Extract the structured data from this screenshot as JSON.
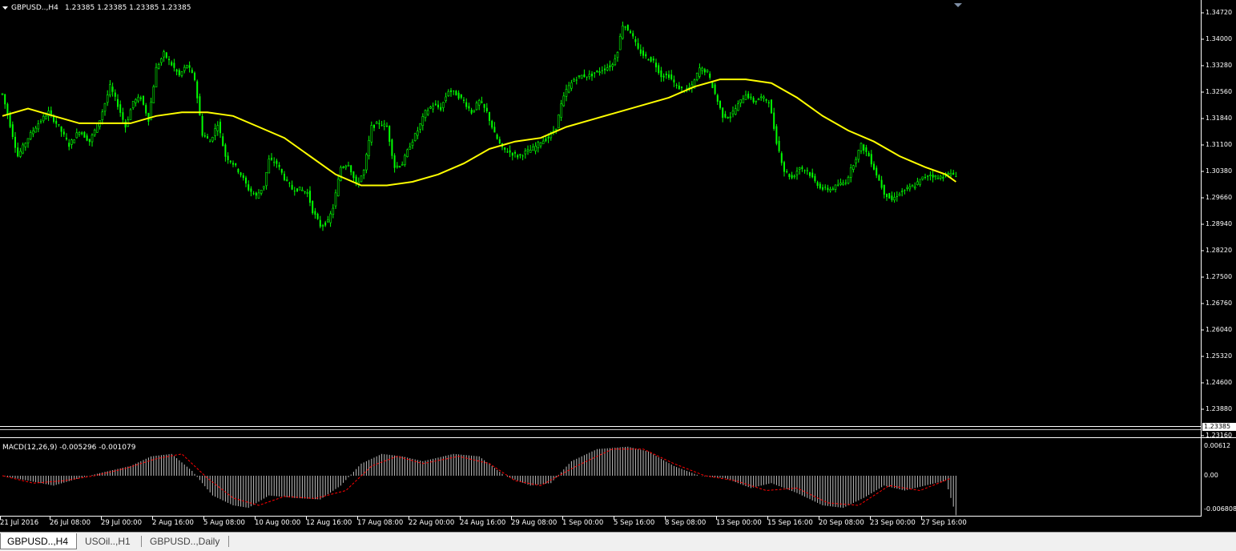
{
  "colors": {
    "background": "#000000",
    "axis": "#ffffff",
    "candle": "#00ff00",
    "moving_average": "#ffff00",
    "macd_histogram": "#c0c0c0",
    "macd_signal": "#ff0000",
    "bid_line": "#c0c0c0"
  },
  "chart_header": {
    "menu_icon": "triangle-down-icon",
    "symbol": "GBPUSD..,H4",
    "ohlc": "1.23385 1.23385 1.23385 1.23385"
  },
  "macd_header": {
    "label": "MACD(12,26,9) -0.005296 -0.001079"
  },
  "price_axis": {
    "ticks": [
      "1.34720",
      "1.34000",
      "1.33280",
      "1.32560",
      "1.31840",
      "1.31100",
      "1.30380",
      "1.29660",
      "1.28940",
      "1.28220",
      "1.27500",
      "1.26760",
      "1.26040",
      "1.25320",
      "1.24600",
      "1.23880",
      "1.23160"
    ],
    "current_price": "1.23385"
  },
  "macd_axis": {
    "ticks": [
      "0.00612",
      "0.00",
      "-0.006808"
    ]
  },
  "time_axis": {
    "labels": [
      "21 Jul 2016",
      "26 Jul 08:00",
      "29 Jul 00:00",
      "2 Aug 16:00",
      "5 Aug 08:00",
      "10 Aug 00:00",
      "12 Aug 16:00",
      "17 Aug 08:00",
      "22 Aug 00:00",
      "24 Aug 16:00",
      "29 Aug 08:00",
      "1 Sep 00:00",
      "5 Sep 16:00",
      "8 Sep 08:00",
      "13 Sep 00:00",
      "15 Sep 16:00",
      "20 Sep 08:00",
      "23 Sep 00:00",
      "27 Sep 16:00"
    ]
  },
  "chart_data": {
    "type": "line",
    "price_ylim": [
      1.2295,
      1.3495
    ],
    "macd_ylim": [
      -0.0075,
      0.0078
    ],
    "price_path": [
      [
        0,
        1.325
      ],
      [
        6,
        1.308
      ],
      [
        10,
        1.313
      ],
      [
        14,
        1.317
      ],
      [
        18,
        1.32
      ],
      [
        22,
        1.316
      ],
      [
        26,
        1.311
      ],
      [
        30,
        1.315
      ],
      [
        34,
        1.312
      ],
      [
        38,
        1.318
      ],
      [
        42,
        1.327
      ],
      [
        45,
        1.322
      ],
      [
        48,
        1.316
      ],
      [
        51,
        1.323
      ],
      [
        54,
        1.324
      ],
      [
        57,
        1.318
      ],
      [
        60,
        1.332
      ],
      [
        63,
        1.336
      ],
      [
        66,
        1.333
      ],
      [
        69,
        1.33
      ],
      [
        72,
        1.333
      ],
      [
        75,
        1.329
      ],
      [
        78,
        1.314
      ],
      [
        81,
        1.312
      ],
      [
        84,
        1.317
      ],
      [
        87,
        1.308
      ],
      [
        90,
        1.306
      ],
      [
        93,
        1.303
      ],
      [
        96,
        1.299
      ],
      [
        99,
        1.297
      ],
      [
        102,
        1.3
      ],
      [
        104,
        1.307
      ],
      [
        107,
        1.306
      ],
      [
        110,
        1.302
      ],
      [
        113,
        1.299
      ],
      [
        116,
        1.299
      ],
      [
        119,
        1.298
      ],
      [
        121,
        1.293
      ],
      [
        124,
        1.289
      ],
      [
        127,
        1.29
      ],
      [
        129,
        1.294
      ],
      [
        132,
        1.305
      ],
      [
        135,
        1.306
      ],
      [
        138,
        1.3
      ],
      [
        141,
        1.304
      ],
      [
        144,
        1.316
      ],
      [
        147,
        1.317
      ],
      [
        150,
        1.316
      ],
      [
        153,
        1.305
      ],
      [
        156,
        1.306
      ],
      [
        159,
        1.311
      ],
      [
        162,
        1.315
      ],
      [
        165,
        1.32
      ],
      [
        168,
        1.322
      ],
      [
        171,
        1.321
      ],
      [
        174,
        1.326
      ],
      [
        177,
        1.325
      ],
      [
        180,
        1.323
      ],
      [
        183,
        1.32
      ],
      [
        186,
        1.323
      ],
      [
        189,
        1.32
      ],
      [
        192,
        1.314
      ],
      [
        195,
        1.31
      ],
      [
        198,
        1.309
      ],
      [
        201,
        1.308
      ],
      [
        204,
        1.309
      ],
      [
        207,
        1.31
      ],
      [
        210,
        1.312
      ],
      [
        213,
        1.313
      ],
      [
        216,
        1.316
      ],
      [
        218,
        1.322
      ],
      [
        220,
        1.326
      ],
      [
        223,
        1.329
      ],
      [
        226,
        1.33
      ],
      [
        229,
        1.33
      ],
      [
        232,
        1.331
      ],
      [
        235,
        1.332
      ],
      [
        238,
        1.333
      ],
      [
        240,
        1.337
      ],
      [
        242,
        1.344
      ],
      [
        245,
        1.342
      ],
      [
        248,
        1.337
      ],
      [
        251,
        1.335
      ],
      [
        254,
        1.334
      ],
      [
        257,
        1.33
      ],
      [
        260,
        1.33
      ],
      [
        263,
        1.327
      ],
      [
        266,
        1.326
      ],
      [
        269,
        1.327
      ],
      [
        272,
        1.332
      ],
      [
        275,
        1.331
      ],
      [
        278,
        1.325
      ],
      [
        281,
        1.319
      ],
      [
        284,
        1.319
      ],
      [
        287,
        1.322
      ],
      [
        290,
        1.325
      ],
      [
        293,
        1.323
      ],
      [
        296,
        1.324
      ],
      [
        299,
        1.323
      ],
      [
        302,
        1.312
      ],
      [
        305,
        1.304
      ],
      [
        308,
        1.302
      ],
      [
        311,
        1.305
      ],
      [
        314,
        1.304
      ],
      [
        317,
        1.301
      ],
      [
        320,
        1.299
      ],
      [
        323,
        1.299
      ],
      [
        326,
        1.3
      ],
      [
        329,
        1.301
      ],
      [
        332,
        1.306
      ],
      [
        335,
        1.311
      ],
      [
        338,
        1.308
      ],
      [
        341,
        1.303
      ],
      [
        344,
        1.298
      ],
      [
        347,
        1.296
      ],
      [
        350,
        1.298
      ],
      [
        353,
        1.299
      ],
      [
        356,
        1.3
      ],
      [
        359,
        1.302
      ],
      [
        362,
        1.303
      ],
      [
        365,
        1.302
      ],
      [
        368,
        1.303
      ],
      [
        371,
        1.303
      ]
    ],
    "ma_path": [
      [
        0,
        1.319
      ],
      [
        10,
        1.321
      ],
      [
        20,
        1.319
      ],
      [
        30,
        1.317
      ],
      [
        40,
        1.317
      ],
      [
        50,
        1.317
      ],
      [
        60,
        1.319
      ],
      [
        70,
        1.32
      ],
      [
        80,
        1.32
      ],
      [
        90,
        1.319
      ],
      [
        100,
        1.316
      ],
      [
        110,
        1.313
      ],
      [
        120,
        1.308
      ],
      [
        130,
        1.303
      ],
      [
        140,
        1.3
      ],
      [
        150,
        1.3
      ],
      [
        160,
        1.301
      ],
      [
        170,
        1.303
      ],
      [
        180,
        1.306
      ],
      [
        190,
        1.31
      ],
      [
        200,
        1.312
      ],
      [
        210,
        1.313
      ],
      [
        220,
        1.316
      ],
      [
        230,
        1.318
      ],
      [
        240,
        1.32
      ],
      [
        250,
        1.322
      ],
      [
        260,
        1.324
      ],
      [
        270,
        1.327
      ],
      [
        280,
        1.329
      ],
      [
        290,
        1.329
      ],
      [
        300,
        1.328
      ],
      [
        310,
        1.324
      ],
      [
        320,
        1.319
      ],
      [
        330,
        1.315
      ],
      [
        340,
        1.312
      ],
      [
        350,
        1.308
      ],
      [
        360,
        1.305
      ],
      [
        368,
        1.303
      ],
      [
        372,
        1.301
      ]
    ],
    "macd_hist_path": [
      [
        0,
        0.0
      ],
      [
        10,
        -0.001
      ],
      [
        20,
        -0.002
      ],
      [
        30,
        -0.0005
      ],
      [
        40,
        0.0008
      ],
      [
        50,
        0.002
      ],
      [
        58,
        0.004
      ],
      [
        66,
        0.0045
      ],
      [
        74,
        0.001
      ],
      [
        82,
        -0.004
      ],
      [
        90,
        -0.006
      ],
      [
        96,
        -0.0065
      ],
      [
        104,
        -0.004
      ],
      [
        114,
        -0.0045
      ],
      [
        124,
        -0.0048
      ],
      [
        132,
        -0.002
      ],
      [
        140,
        0.0025
      ],
      [
        148,
        0.0045
      ],
      [
        156,
        0.004
      ],
      [
        164,
        0.003
      ],
      [
        176,
        0.0045
      ],
      [
        186,
        0.004
      ],
      [
        196,
        0.0
      ],
      [
        206,
        -0.002
      ],
      [
        214,
        -0.0015
      ],
      [
        222,
        0.003
      ],
      [
        232,
        0.0055
      ],
      [
        244,
        0.006
      ],
      [
        252,
        0.005
      ],
      [
        262,
        0.002
      ],
      [
        272,
        0.0
      ],
      [
        282,
        -0.0005
      ],
      [
        292,
        -0.0025
      ],
      [
        300,
        -0.0015
      ],
      [
        310,
        -0.0035
      ],
      [
        320,
        -0.006
      ],
      [
        328,
        -0.0065
      ],
      [
        336,
        -0.0045
      ],
      [
        344,
        -0.002
      ],
      [
        352,
        -0.003
      ],
      [
        360,
        -0.002
      ],
      [
        368,
        -0.001
      ],
      [
        372,
        -0.008
      ]
    ],
    "macd_signal_path": [
      [
        0,
        0.0
      ],
      [
        12,
        -0.0015
      ],
      [
        24,
        -0.001
      ],
      [
        36,
        0.0
      ],
      [
        48,
        0.0015
      ],
      [
        60,
        0.0035
      ],
      [
        70,
        0.0045
      ],
      [
        80,
        -0.0005
      ],
      [
        90,
        -0.0045
      ],
      [
        100,
        -0.006
      ],
      [
        110,
        -0.0042
      ],
      [
        122,
        -0.0046
      ],
      [
        134,
        -0.003
      ],
      [
        144,
        0.002
      ],
      [
        154,
        0.004
      ],
      [
        164,
        0.0025
      ],
      [
        178,
        0.004
      ],
      [
        190,
        0.0025
      ],
      [
        200,
        -0.001
      ],
      [
        210,
        -0.002
      ],
      [
        224,
        0.002
      ],
      [
        238,
        0.0055
      ],
      [
        250,
        0.0055
      ],
      [
        262,
        0.0025
      ],
      [
        274,
        0.0
      ],
      [
        286,
        -0.001
      ],
      [
        298,
        -0.003
      ],
      [
        310,
        -0.0025
      ],
      [
        322,
        -0.0055
      ],
      [
        334,
        -0.006
      ],
      [
        346,
        -0.002
      ],
      [
        358,
        -0.003
      ],
      [
        370,
        -0.0005
      ]
    ],
    "bar_count": 373
  },
  "tabs": [
    {
      "label": "GBPUSD..,H4",
      "active": true
    },
    {
      "label": "USOil..,H1",
      "active": false
    },
    {
      "label": "GBPUSD..,Daily",
      "active": false
    }
  ]
}
